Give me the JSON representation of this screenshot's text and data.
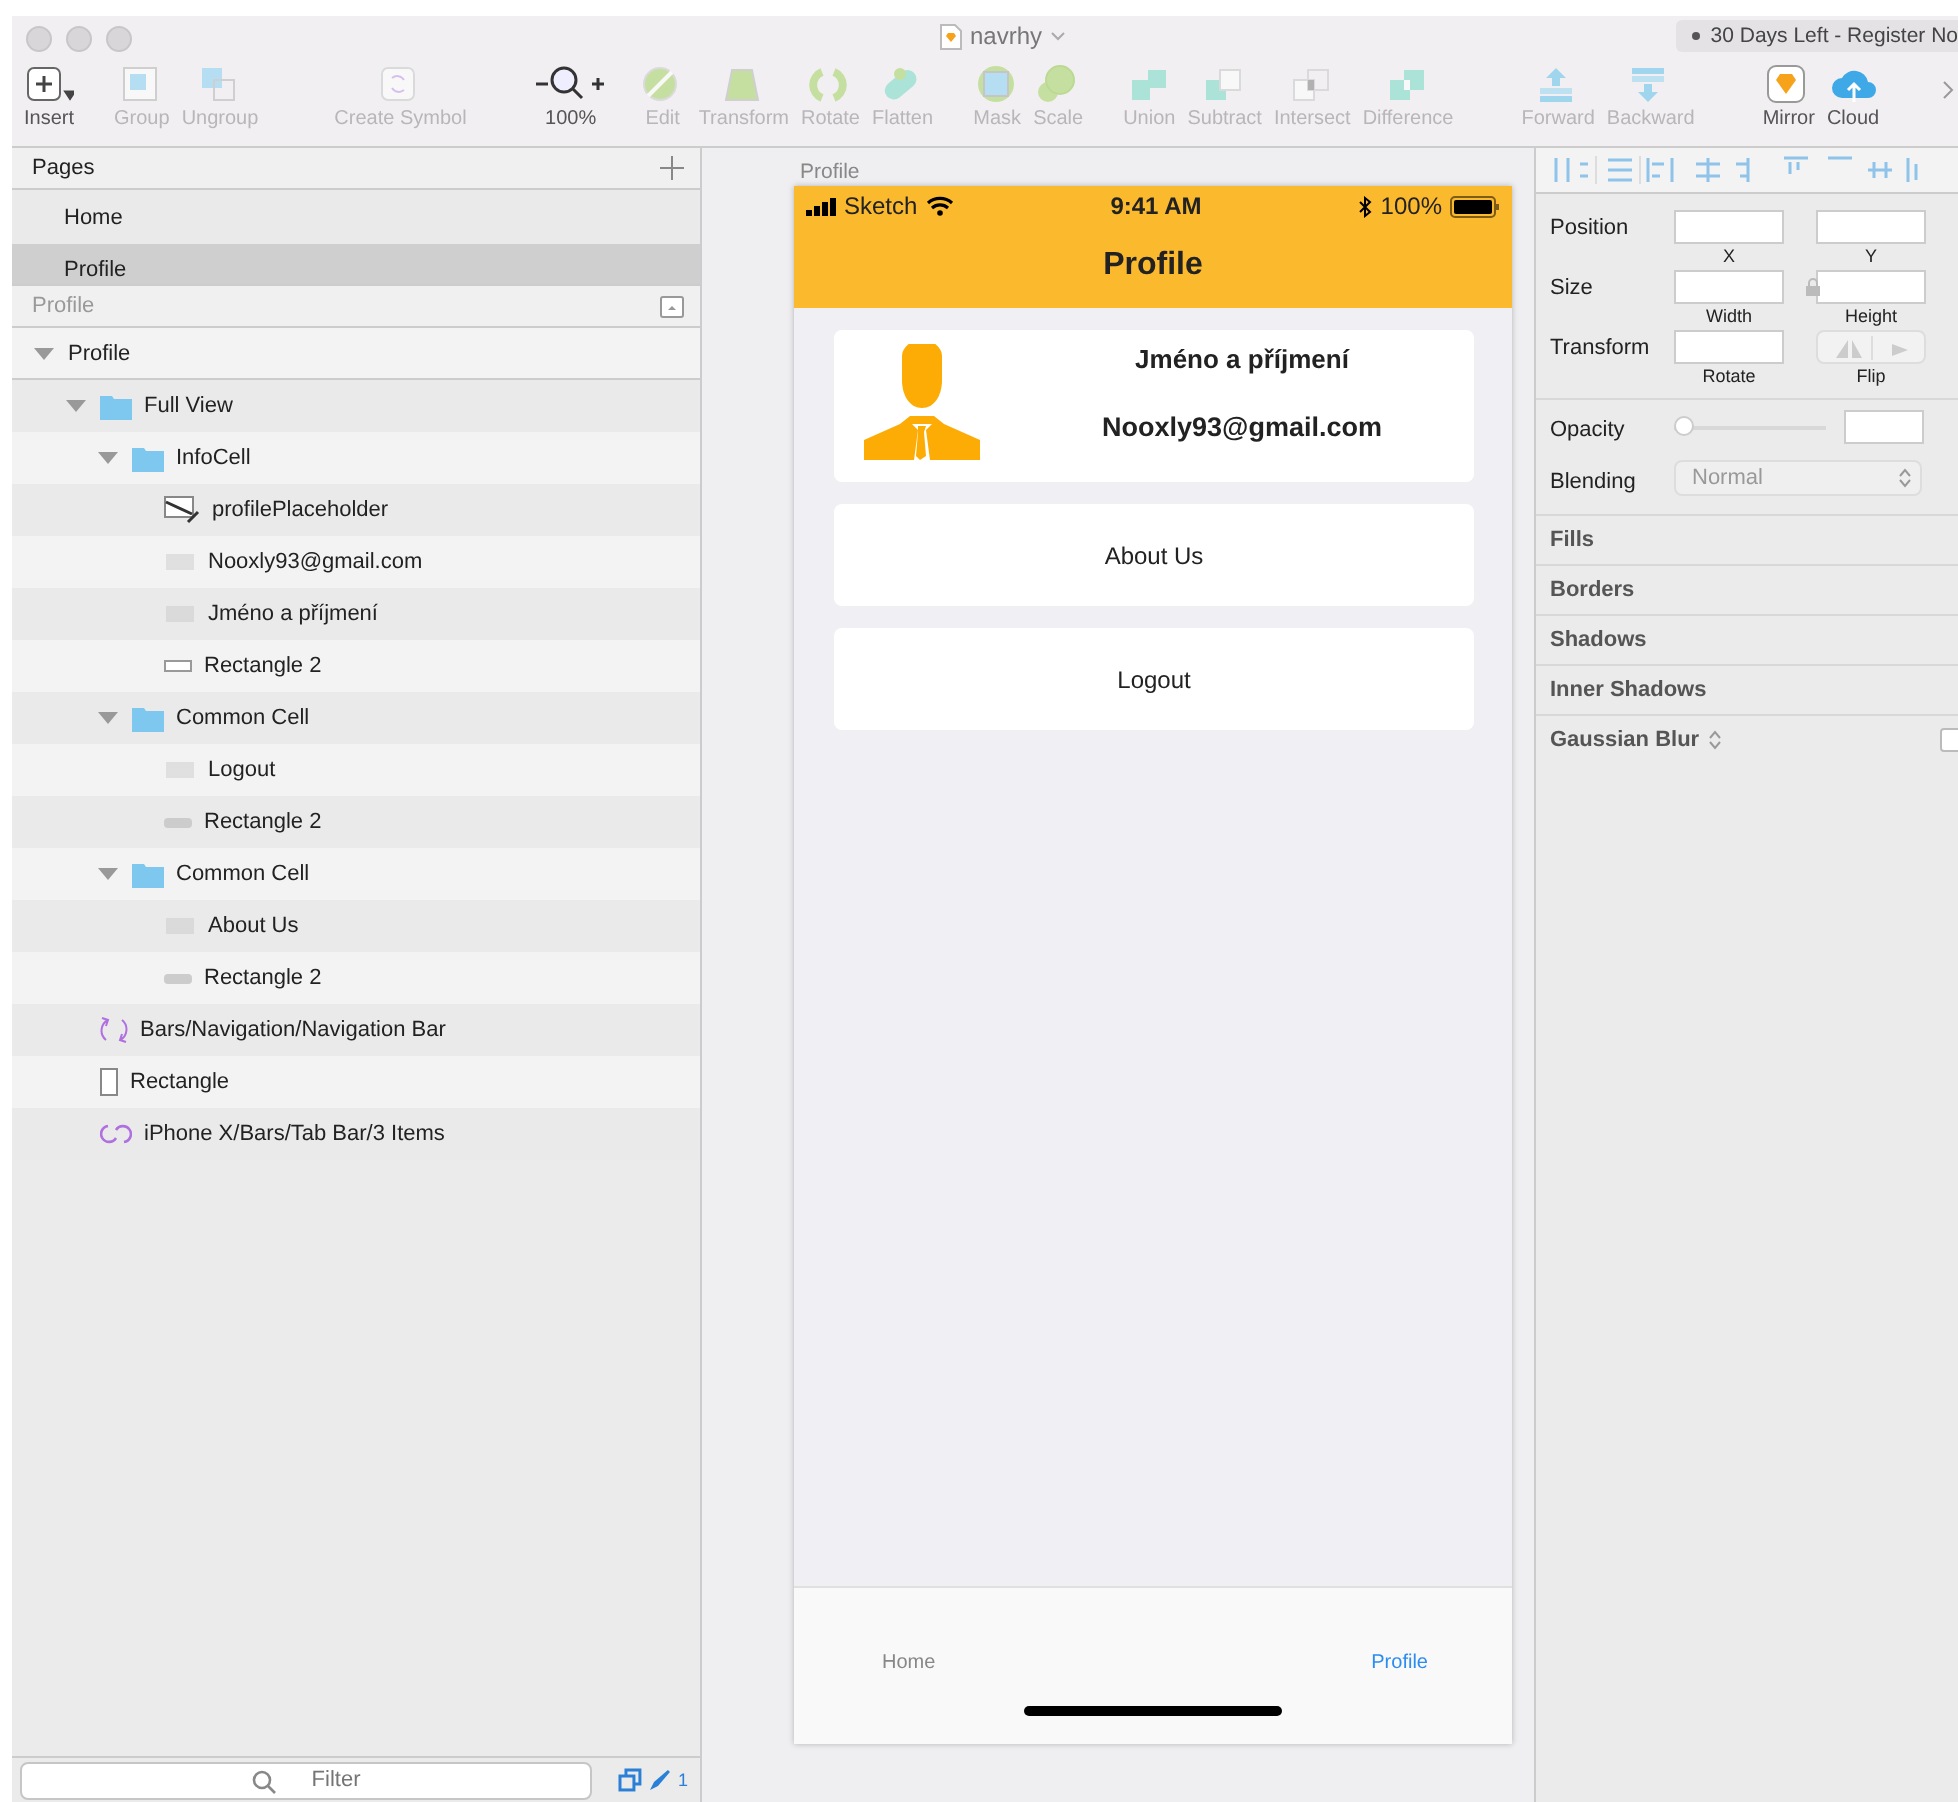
{
  "window": {
    "title": "navrhy",
    "trial_notice": "30 Days Left - Register No"
  },
  "toolbar": {
    "groups": [
      [
        {
          "label": "Insert",
          "kind": "insert",
          "disabled": false
        }
      ],
      [
        {
          "label": "Group",
          "kind": "group",
          "disabled": true
        },
        {
          "label": "Ungroup",
          "kind": "ungroup",
          "disabled": true
        }
      ],
      [
        {
          "label": "Create Symbol",
          "kind": "symbol",
          "disabled": true
        }
      ],
      [
        {
          "label": "100%",
          "kind": "zoom",
          "disabled": false
        }
      ],
      [
        {
          "label": "Edit",
          "kind": "edit",
          "disabled": true
        },
        {
          "label": "Transform",
          "kind": "transform",
          "disabled": true
        },
        {
          "label": "Rotate",
          "kind": "rotate",
          "disabled": true
        },
        {
          "label": "Flatten",
          "kind": "flatten",
          "disabled": true
        }
      ],
      [
        {
          "label": "Mask",
          "kind": "mask",
          "disabled": true
        },
        {
          "label": "Scale",
          "kind": "scale",
          "disabled": true
        }
      ],
      [
        {
          "label": "Union",
          "kind": "union",
          "disabled": true
        },
        {
          "label": "Subtract",
          "kind": "subtract",
          "disabled": true
        },
        {
          "label": "Intersect",
          "kind": "intersect",
          "disabled": true
        },
        {
          "label": "Difference",
          "kind": "difference",
          "disabled": true
        }
      ],
      [
        {
          "label": "Forward",
          "kind": "forward",
          "disabled": true
        },
        {
          "label": "Backward",
          "kind": "backward",
          "disabled": true
        }
      ],
      [
        {
          "label": "Mirror",
          "kind": "mirror",
          "disabled": false
        },
        {
          "label": "Cloud",
          "kind": "cloud",
          "disabled": false
        }
      ]
    ]
  },
  "pages": {
    "title": "Pages",
    "items": [
      {
        "label": "Home",
        "selected": false
      },
      {
        "label": "Profile",
        "selected": true
      }
    ]
  },
  "layers": {
    "title": "Profile",
    "tree": [
      {
        "label": "Profile",
        "kind": "artboard",
        "expanded": true,
        "children": [
          {
            "label": "Full View",
            "kind": "folder",
            "expanded": true,
            "children": [
              {
                "label": "InfoCell",
                "kind": "folder",
                "expanded": true,
                "children": [
                  {
                    "label": "profilePlaceholder",
                    "kind": "image"
                  },
                  {
                    "label": "Nooxly93@gmail.com",
                    "kind": "text"
                  },
                  {
                    "label": "Jméno a příjmení",
                    "kind": "text"
                  },
                  {
                    "label": "Rectangle 2",
                    "kind": "outline-rect"
                  }
                ]
              },
              {
                "label": "Common Cell",
                "kind": "folder",
                "expanded": true,
                "children": [
                  {
                    "label": "Logout",
                    "kind": "text"
                  },
                  {
                    "label": "Rectangle 2",
                    "kind": "filled-rect"
                  }
                ]
              },
              {
                "label": "Common Cell",
                "kind": "folder",
                "expanded": true,
                "children": [
                  {
                    "label": "About Us",
                    "kind": "text"
                  },
                  {
                    "label": "Rectangle 2",
                    "kind": "filled-rect"
                  }
                ]
              }
            ]
          },
          {
            "label": "Bars/Navigation/Navigation Bar",
            "kind": "symbol"
          },
          {
            "label": "Rectangle",
            "kind": "tall-rect"
          },
          {
            "label": "iPhone X/Bars/Tab Bar/3 Items",
            "kind": "symbol-link"
          }
        ]
      }
    ],
    "filter": {
      "placeholder": "Filter",
      "count": "1"
    }
  },
  "canvas": {
    "artboard_label": "Profile",
    "phone": {
      "status": {
        "carrier": "Sketch",
        "time": "9:41 AM",
        "battery": "100%"
      },
      "title": "Profile",
      "info_cell": {
        "name": "Jméno a příjmení",
        "email": "Nooxly93@gmail.com"
      },
      "cells": [
        "About Us",
        "Logout"
      ],
      "tabs": [
        {
          "label": "Home",
          "selected": false
        },
        {
          "label": "Profile",
          "selected": true
        }
      ]
    }
  },
  "inspector": {
    "rows": [
      {
        "label": "Position",
        "fields": [
          {
            "caption": "X"
          },
          {
            "caption": "Y"
          }
        ]
      },
      {
        "label": "Size",
        "fields": [
          {
            "caption": "Width"
          },
          {
            "caption": "Height"
          }
        ]
      },
      {
        "label": "Transform",
        "fields": [
          {
            "caption": "Rotate"
          }
        ],
        "flip": "Flip"
      }
    ],
    "opacity": {
      "label": "Opacity",
      "level": 0
    },
    "blending": {
      "label": "Blending",
      "value": "Normal"
    },
    "sections": [
      {
        "label": "Fills",
        "kind": "plain"
      },
      {
        "label": "Borders",
        "kind": "plain"
      },
      {
        "label": "Shadows",
        "kind": "plain"
      },
      {
        "label": "Inner Shadows",
        "kind": "plain"
      },
      {
        "label": "Gaussian Blur",
        "kind": "toggle",
        "checked": false
      }
    ]
  }
}
